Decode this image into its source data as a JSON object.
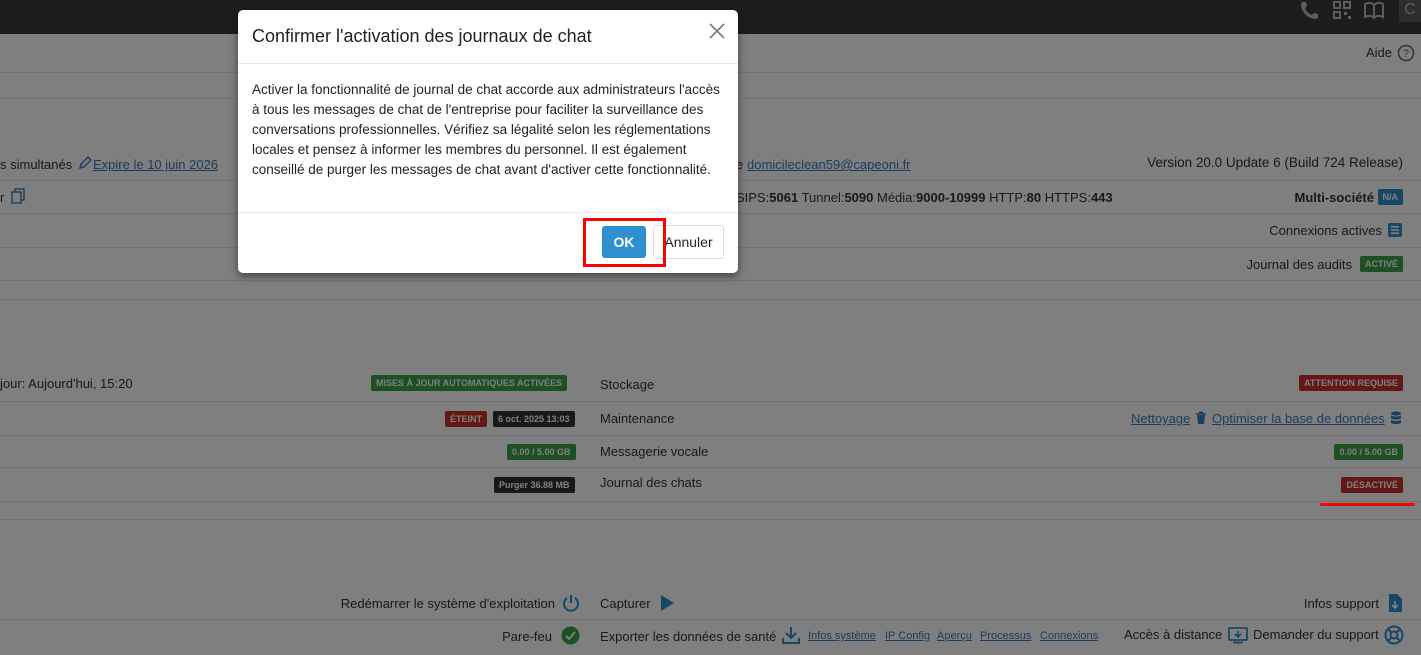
{
  "topbar": {
    "right_char": "C"
  },
  "help": {
    "label": "Aide"
  },
  "license": {
    "left_text": "s simultanés",
    "expiry_link": "Expire le 10 juin 2026",
    "email_prefix": "e",
    "email_link": "domicileclean59@capeoni.fr",
    "version": "Version 20.0 Update 6 (Build 724 Release)"
  },
  "row2": {
    "left_text": "r",
    "ports": [
      {
        "label": "SIPS:",
        "value": "5061"
      },
      {
        "label": "Tunnel:",
        "value": "5090"
      },
      {
        "label": "Média:",
        "value": "9000-10999"
      },
      {
        "label": "HTTP:",
        "value": "80"
      },
      {
        "label": "HTTPS:",
        "value": "443"
      }
    ],
    "multi_company": "Multi-société",
    "multi_badge": "N/A"
  },
  "row3": {
    "active_connections": "Connexions actives"
  },
  "row4": {
    "audit_log": "Journal des audits",
    "audit_badge": "ACTIVÉ"
  },
  "status": {
    "update_text": "jour: Aujourd'hui, 15:20",
    "auto_update_badge": "MISES À JOUR AUTOMATIQUES ACTIVÉES",
    "storage_label": "Stockage",
    "storage_badge": "ATTENTION REQUISE",
    "backup_off_badge": "ÉTEINT",
    "backup_date_badge": "6 oct. 2025 13:03",
    "maintenance_label": "Maintenance",
    "cleanup_link": "Nettoyage",
    "optimize_link": "Optimiser la base de données",
    "recordings_badge": "0.00 / 5.00 GB",
    "voicemail_label": "Messagerie vocale",
    "voicemail_badge": "0.00 / 5.00 GB",
    "purge_badge": "Purger 36.88 MB",
    "chat_log_label": "Journal des chats",
    "chat_log_badge": "DÉSACTIVÉ"
  },
  "actions": {
    "restart_os": "Redémarrer le système d'exploitation",
    "capture": "Capturer",
    "support_info": "Infos support",
    "firewall": "Pare-feu",
    "export_health": "Exporter les données de santé",
    "links": [
      "Infos système",
      "IP Config",
      "Aperçu",
      "Processus",
      "Connexions"
    ],
    "remote_access": "Accès à distance",
    "request_support": "Demander du support"
  },
  "modal": {
    "title": "Confirmer l'activation des journaux de chat",
    "body": "Activer la fonctionnalité de journal de chat accorde aux administrateurs l'accès à tous les messages de chat de l'entreprise pour faciliter la surveillance des conversations professionnelles. Vérifiez sa légalité selon les réglementations locales et pensez à informer les membres du personnel. Il est également conseillé de purger les messages de chat avant d'activer cette fonctionnalité.",
    "ok_label": "OK",
    "cancel_label": "Annuler"
  },
  "colors": {
    "green": "#3aa247",
    "red": "#c9302c",
    "blue": "#2f8fcf",
    "link": "#3b7bbf",
    "highlight": "#ff0000"
  }
}
